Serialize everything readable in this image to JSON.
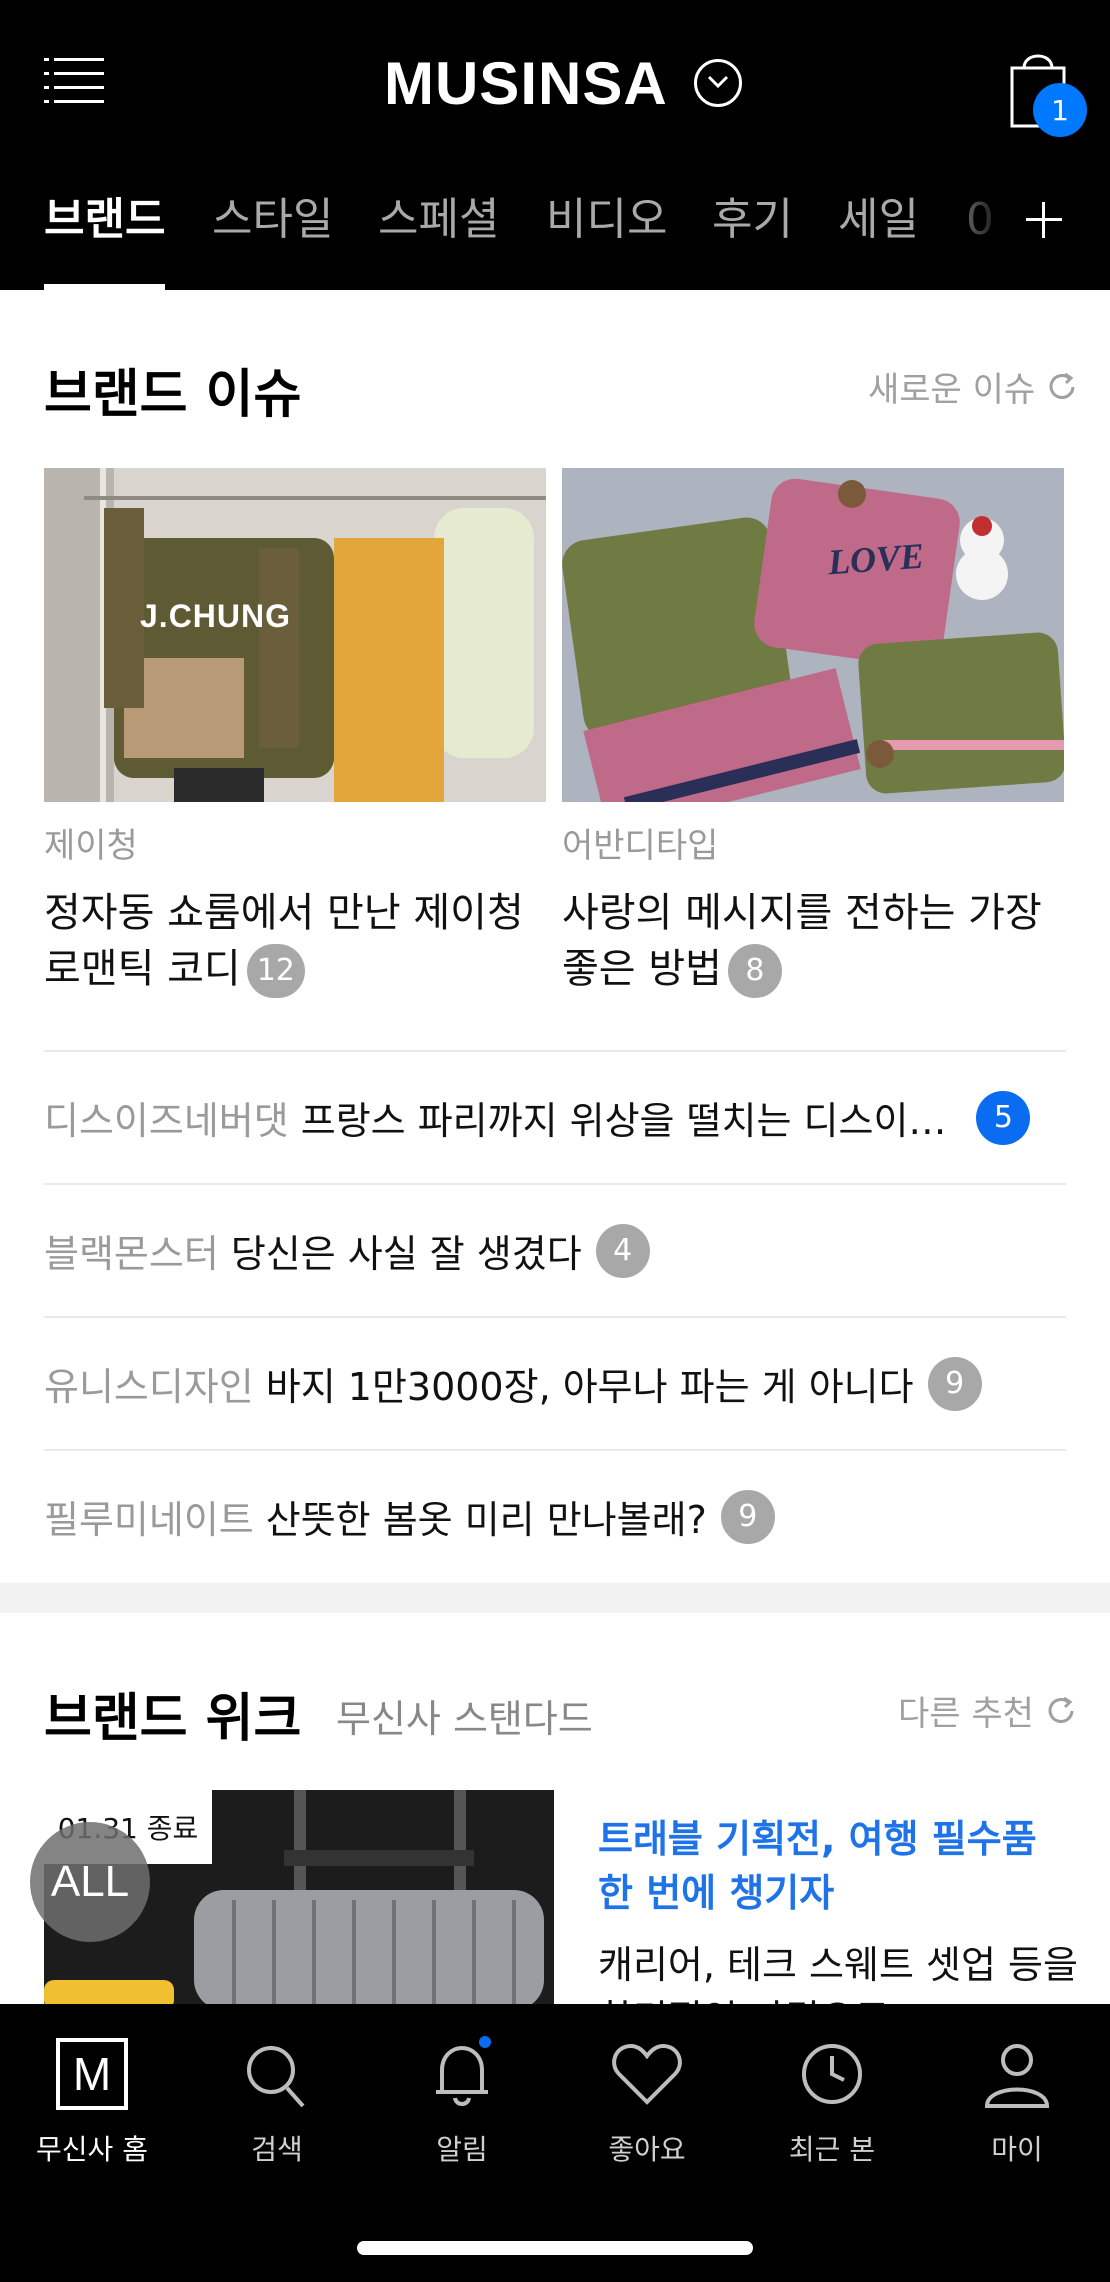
{
  "header": {
    "logo": "MUSINSA",
    "cart_count": "1",
    "tabs": [
      "브랜드",
      "스타일",
      "스페셜",
      "비디오",
      "후기",
      "세일",
      "0"
    ]
  },
  "brand_issue": {
    "title": "브랜드 이슈",
    "refresh_label": "새로운 이슈",
    "cards": [
      {
        "brand": "제이청",
        "title": "정자동 쇼룸에서 만난 제이청 로맨틱 코디",
        "count": "12",
        "image_text": "J.CHUNG"
      },
      {
        "brand": "어반디타입",
        "title": "사랑의 메시지를 전하는 가장 좋은 방법",
        "count": "8",
        "image_text": "LOVE"
      }
    ],
    "list": [
      {
        "brand": "디스이즈네버댓",
        "title": "프랑스 파리까지 위상을 떨치는 디스이…",
        "count": "5"
      },
      {
        "brand": "블랙몬스터",
        "title": "당신은 사실 잘 생겼다",
        "count": "4"
      },
      {
        "brand": "유니스디자인",
        "title": "바지 1만3000장, 아무나 파는 게 아니다",
        "count": "9"
      },
      {
        "brand": "필루미네이트",
        "title": "산뜻한 봄옷 미리 만나볼래?",
        "count": "9"
      }
    ]
  },
  "brand_week": {
    "title": "브랜드 위크",
    "subtitle": "무신사 스탠다드",
    "refresh_label": "다른 추천",
    "tag": "01.31 종료",
    "all_badge": "ALL",
    "headline": "트래블 기획전, 여행 필수품 한 번에 챙기자",
    "desc": "캐리어, 테크 스웨트 셋업 등을 합리적인 가격으로"
  },
  "bottom_nav": {
    "items": [
      "무신사 홈",
      "검색",
      "알림",
      "좋아요",
      "최근 본",
      "마이"
    ],
    "home_icon_letter": "M"
  },
  "colors": {
    "accent_blue": "#0a6cf0",
    "headline_blue": "#1e73e8",
    "header_bg": "#000000"
  }
}
